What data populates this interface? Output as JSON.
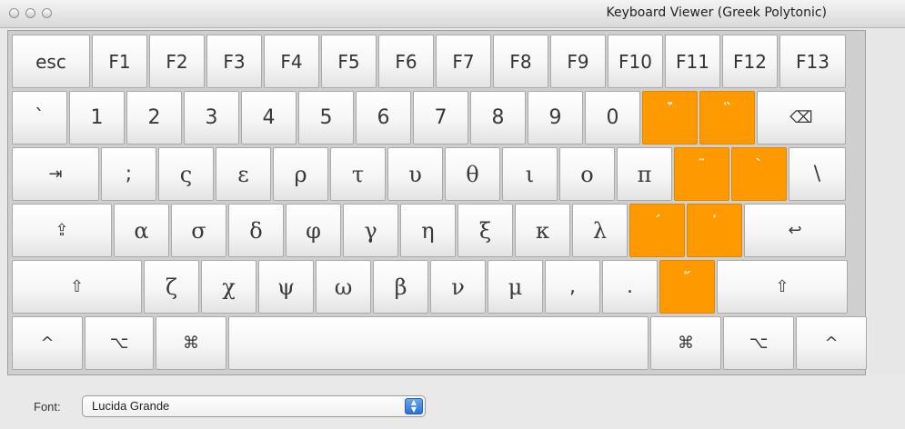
{
  "window": {
    "title": "Keyboard Viewer (Greek Polytonic)"
  },
  "rows": [
    [
      {
        "label": "esc",
        "w": 88,
        "cls": "fn",
        "name": "key-esc"
      },
      {
        "label": "F1",
        "w": 63,
        "cls": "fn",
        "name": "key-f1"
      },
      {
        "label": "F2",
        "w": 63,
        "cls": "fn",
        "name": "key-f2"
      },
      {
        "label": "F3",
        "w": 63,
        "cls": "fn",
        "name": "key-f3"
      },
      {
        "label": "F4",
        "w": 63,
        "cls": "fn",
        "name": "key-f4"
      },
      {
        "label": "F5",
        "w": 63,
        "cls": "fn",
        "name": "key-f5"
      },
      {
        "label": "F6",
        "w": 63,
        "cls": "fn",
        "name": "key-f6"
      },
      {
        "label": "F7",
        "w": 63,
        "cls": "fn",
        "name": "key-f7"
      },
      {
        "label": "F8",
        "w": 63,
        "cls": "fn",
        "name": "key-f8"
      },
      {
        "label": "F9",
        "w": 63,
        "cls": "fn",
        "name": "key-f9"
      },
      {
        "label": "F10",
        "w": 63,
        "cls": "fn",
        "name": "key-f10"
      },
      {
        "label": "F11",
        "w": 63,
        "cls": "fn",
        "name": "key-f11"
      },
      {
        "label": "F12",
        "w": 63,
        "cls": "fn",
        "name": "key-f12"
      },
      {
        "label": "F13",
        "w": 75,
        "cls": "fn",
        "name": "key-f13"
      }
    ],
    [
      {
        "label": "`",
        "w": 63,
        "name": "key-backtick"
      },
      {
        "label": "1",
        "w": 63,
        "name": "key-1"
      },
      {
        "label": "2",
        "w": 63,
        "name": "key-2"
      },
      {
        "label": "3",
        "w": 63,
        "name": "key-3"
      },
      {
        "label": "4",
        "w": 63,
        "name": "key-4"
      },
      {
        "label": "5",
        "w": 63,
        "name": "key-5"
      },
      {
        "label": "6",
        "w": 63,
        "name": "key-6"
      },
      {
        "label": "7",
        "w": 63,
        "name": "key-7"
      },
      {
        "label": "8",
        "w": 63,
        "name": "key-8"
      },
      {
        "label": "9",
        "w": 63,
        "name": "key-9"
      },
      {
        "label": "0",
        "w": 63,
        "name": "key-0"
      },
      {
        "label": "῾̃",
        "w": 63,
        "cls": "orange",
        "name": "key-dead-dasia-perispomeni"
      },
      {
        "label": "῝",
        "w": 63,
        "cls": "orange",
        "name": "key-dead-dasia-varia"
      },
      {
        "label": "⌫",
        "w": 100,
        "cls": "small",
        "name": "delete-icon"
      }
    ],
    [
      {
        "label": "⇥",
        "w": 98,
        "cls": "small",
        "name": "tab-icon"
      },
      {
        "label": ";",
        "w": 63,
        "name": "key-semicolon"
      },
      {
        "label": "ς",
        "w": 63,
        "cls": "greek",
        "name": "key-final-sigma"
      },
      {
        "label": "ε",
        "w": 63,
        "cls": "greek",
        "name": "key-epsilon"
      },
      {
        "label": "ρ",
        "w": 63,
        "cls": "greek",
        "name": "key-rho"
      },
      {
        "label": "τ",
        "w": 63,
        "cls": "greek",
        "name": "key-tau"
      },
      {
        "label": "υ",
        "w": 63,
        "cls": "greek",
        "name": "key-upsilon"
      },
      {
        "label": "θ",
        "w": 63,
        "cls": "greek",
        "name": "key-theta"
      },
      {
        "label": "ι",
        "w": 63,
        "cls": "greek",
        "name": "key-iota"
      },
      {
        "label": "ο",
        "w": 63,
        "cls": "greek",
        "name": "key-omicron"
      },
      {
        "label": "π",
        "w": 63,
        "cls": "greek",
        "name": "key-pi"
      },
      {
        "label": "῀",
        "w": 63,
        "cls": "orange",
        "name": "key-dead-perispomeni"
      },
      {
        "label": "`",
        "w": 63,
        "cls": "orange",
        "name": "key-dead-varia"
      },
      {
        "label": "\\",
        "w": 65,
        "name": "key-backslash"
      }
    ],
    [
      {
        "label": "⇪",
        "w": 112,
        "cls": "small",
        "name": "caps-lock-icon"
      },
      {
        "label": "α",
        "w": 63,
        "cls": "greek",
        "name": "key-alpha"
      },
      {
        "label": "σ",
        "w": 63,
        "cls": "greek",
        "name": "key-sigma"
      },
      {
        "label": "δ",
        "w": 63,
        "cls": "greek",
        "name": "key-delta"
      },
      {
        "label": "φ",
        "w": 63,
        "cls": "greek",
        "name": "key-phi"
      },
      {
        "label": "γ",
        "w": 63,
        "cls": "greek",
        "name": "key-gamma"
      },
      {
        "label": "η",
        "w": 63,
        "cls": "greek",
        "name": "key-eta"
      },
      {
        "label": "ξ",
        "w": 63,
        "cls": "greek",
        "name": "key-xi"
      },
      {
        "label": "κ",
        "w": 63,
        "cls": "greek",
        "name": "key-kappa"
      },
      {
        "label": "λ",
        "w": 63,
        "cls": "greek",
        "name": "key-lambda"
      },
      {
        "label": "´",
        "w": 63,
        "cls": "orange",
        "name": "key-dead-oxia"
      },
      {
        "label": "᾿",
        "w": 63,
        "cls": "orange",
        "name": "key-dead-psili"
      },
      {
        "label": "↩",
        "w": 114,
        "cls": "small",
        "name": "return-icon"
      }
    ],
    [
      {
        "label": "⇧",
        "w": 145,
        "cls": "small",
        "name": "shift-left-icon"
      },
      {
        "label": "ζ",
        "w": 63,
        "cls": "greek",
        "name": "key-zeta"
      },
      {
        "label": "χ",
        "w": 63,
        "cls": "greek",
        "name": "key-chi"
      },
      {
        "label": "ψ",
        "w": 63,
        "cls": "greek",
        "name": "key-psi"
      },
      {
        "label": "ω",
        "w": 63,
        "cls": "greek",
        "name": "key-omega"
      },
      {
        "label": "β",
        "w": 63,
        "cls": "greek",
        "name": "key-beta"
      },
      {
        "label": "ν",
        "w": 63,
        "cls": "greek",
        "name": "key-nu"
      },
      {
        "label": "μ",
        "w": 63,
        "cls": "greek",
        "name": "key-mu"
      },
      {
        "label": ",",
        "w": 63,
        "name": "key-comma"
      },
      {
        "label": ".",
        "w": 63,
        "name": "key-period"
      },
      {
        "label": "῎",
        "w": 63,
        "cls": "orange",
        "name": "key-dead-psili-oxia"
      },
      {
        "label": "⇧",
        "w": 146,
        "cls": "small",
        "name": "shift-right-icon"
      }
    ],
    [
      {
        "label": "^",
        "w": 80,
        "cls": "small",
        "name": "control-left-icon"
      },
      {
        "label": "⌥",
        "w": 78,
        "cls": "small",
        "name": "option-left-icon"
      },
      {
        "label": "⌘",
        "w": 80,
        "cls": "small",
        "name": "command-left-icon"
      },
      {
        "label": "",
        "w": 464,
        "cls": "space",
        "name": "space-bar"
      },
      {
        "label": "⌘",
        "w": 80,
        "cls": "small",
        "name": "command-right-icon"
      },
      {
        "label": "⌥",
        "w": 80,
        "cls": "small",
        "name": "option-right-icon"
      },
      {
        "label": "^",
        "w": 80,
        "cls": "small",
        "name": "control-right-icon"
      }
    ]
  ],
  "font": {
    "label": "Font:",
    "value": "Lucida Grande"
  }
}
